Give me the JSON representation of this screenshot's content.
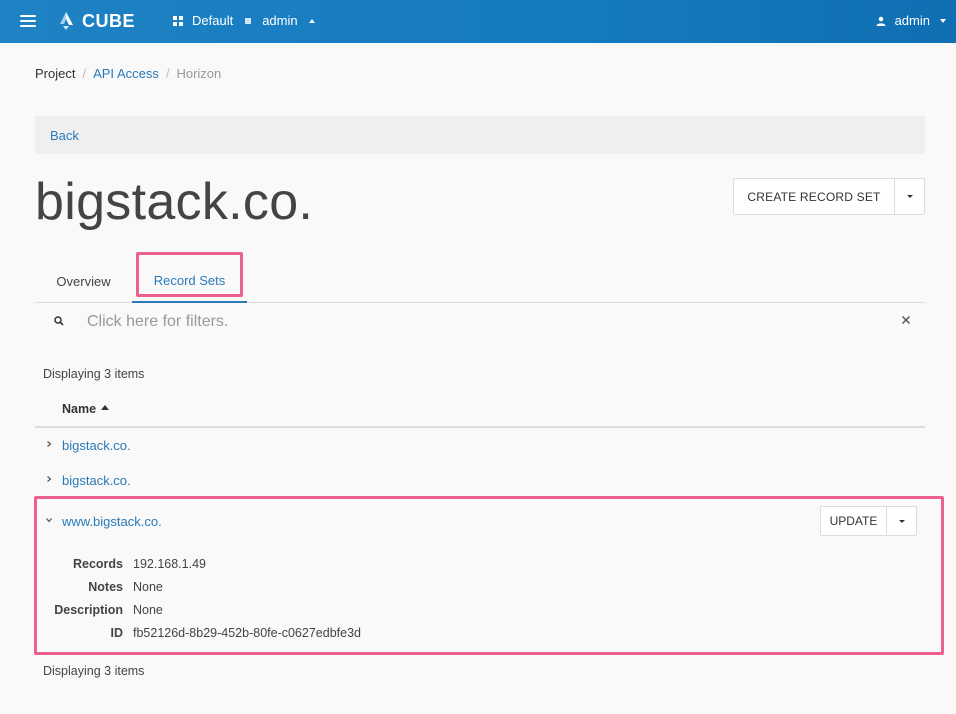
{
  "header": {
    "brand": "CUBE",
    "domain": "Default",
    "project": "admin",
    "user": "admin"
  },
  "breadcrumb": [
    "Project",
    "API Access",
    "Horizon"
  ],
  "back_label": "Back",
  "page_title": "bigstack.co.",
  "actions": {
    "create_label": "CREATE RECORD SET"
  },
  "tabs": [
    {
      "label": "Overview",
      "active": false
    },
    {
      "label": "Record Sets",
      "active": true
    }
  ],
  "filter": {
    "placeholder": "Click here for filters."
  },
  "count_text": "Displaying 3 items",
  "table": {
    "column_name": "Name",
    "rows": [
      {
        "name": "bigstack.co.",
        "expanded": false
      },
      {
        "name": "bigstack.co.",
        "expanded": false
      },
      {
        "name": "www.bigstack.co.",
        "expanded": true,
        "update_label": "UPDATE",
        "details": [
          {
            "label": "Records",
            "value": "192.168.1.49"
          },
          {
            "label": "Notes",
            "value": "None"
          },
          {
            "label": "Description",
            "value": "None"
          },
          {
            "label": "ID",
            "value": "fb52126d-8b29-452b-80fe-c0627edbfe3d"
          }
        ]
      }
    ]
  },
  "colors": {
    "accent": "#2a7ab8",
    "header": "#1e82c4",
    "highlight": "#ec5f8f"
  },
  "icons": [
    "menu-icon",
    "cube-logo-icon",
    "projects-grid-icon",
    "user-icon",
    "search-icon",
    "clear-icon",
    "chevron-right-icon",
    "chevron-down-icon",
    "sort-ascending-icon"
  ]
}
